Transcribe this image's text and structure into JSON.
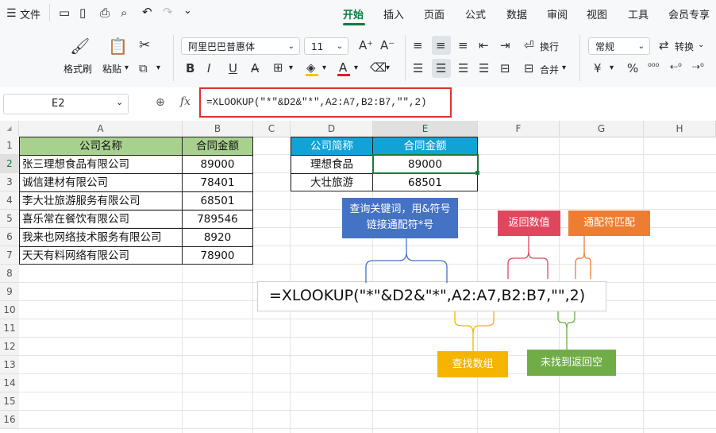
{
  "menu": {
    "file": "文件",
    "tabs": [
      "开始",
      "插入",
      "页面",
      "公式",
      "数据",
      "审阅",
      "视图",
      "工具",
      "会员专享"
    ]
  },
  "ribbon": {
    "format_painter": "格式刷",
    "paste": "粘贴",
    "font_name": "阿里巴巴普惠体",
    "font_size": "11",
    "wrap": "换行",
    "number_format": "常规",
    "convert": "转换",
    "merge": "合并",
    "currency_symbol": "¥"
  },
  "formula_bar": {
    "cell_ref": "E2",
    "fx": "fx",
    "formula": "=XLOOKUP(\"*\"&D2&\"*\",A2:A7,B2:B7,\"\",2)"
  },
  "grid": {
    "columns": [
      "A",
      "B",
      "C",
      "D",
      "E",
      "F",
      "G",
      "H"
    ],
    "rows": [
      "1",
      "2",
      "3",
      "4",
      "5",
      "6",
      "7",
      "8",
      "9",
      "10",
      "11",
      "12",
      "13",
      "14",
      "15",
      "16"
    ],
    "left_table": {
      "headers": [
        "公司名称",
        "合同金额"
      ],
      "rows": [
        [
          "张三理想食品有限公司",
          "89000"
        ],
        [
          "诚信建材有限公司",
          "78401"
        ],
        [
          "李大壮旅游服务有限公司",
          "68501"
        ],
        [
          "喜乐常在餐饮有限公司",
          "789546"
        ],
        [
          "我来也网络技术服务有限公司",
          "8920"
        ],
        [
          "天天有料网络有限公司",
          "78900"
        ]
      ]
    },
    "right_table": {
      "headers": [
        "公司简称",
        "合同金额"
      ],
      "rows": [
        [
          "理想食品",
          "89000"
        ],
        [
          "大壮旅游",
          "68501"
        ]
      ]
    }
  },
  "annotations": {
    "formula_display": "=XLOOKUP(\"*\"&D2&\"*\",A2:A7,B2:B7,\"\",2)",
    "query_key": "查询关键词，用&符号链接通配符*号",
    "return_value": "返回数值",
    "wildcard_match": "通配符匹配",
    "lookup_array": "查找数组",
    "not_found": "未找到返回空"
  },
  "colors": {
    "green_header": "#a9d18e",
    "blue_header": "#12a3d6",
    "ann_blue": "#4472c4",
    "ann_red": "#e0475e",
    "ann_orange": "#ed7d31",
    "ann_yellow": "#f4b400",
    "ann_green": "#70ad47",
    "accent": "#0a7d3f"
  }
}
